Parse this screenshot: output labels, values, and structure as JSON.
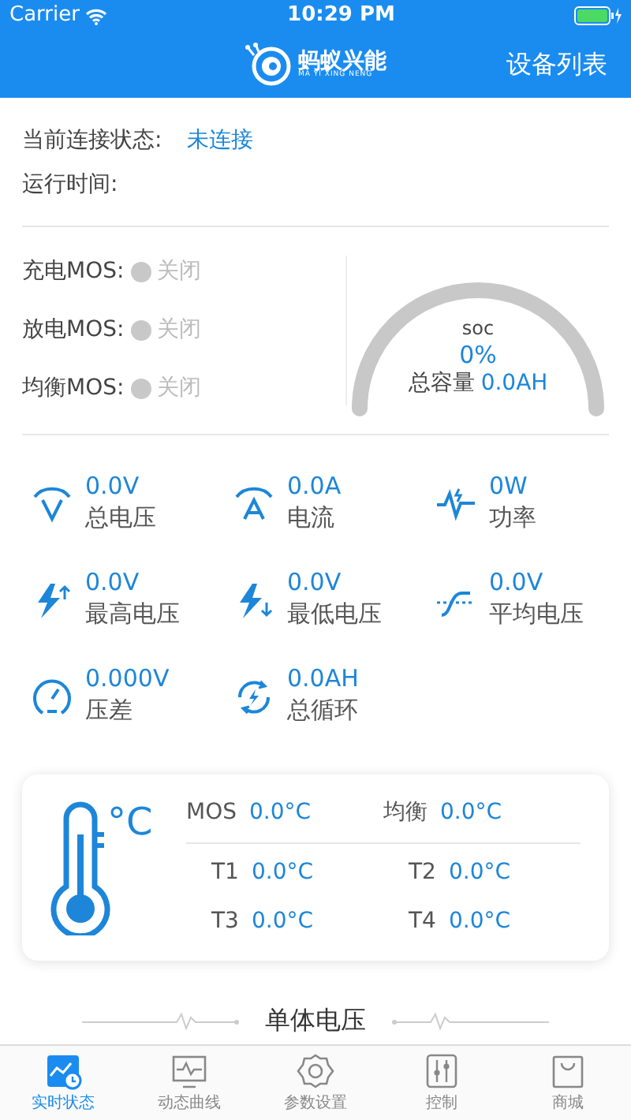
{
  "status_bar": {
    "carrier": "Carrier",
    "time": "10:29 PM"
  },
  "nav": {
    "logo_title": "蚂蚁兴能",
    "logo_subtitle": "MA YI XING NENG",
    "action": "设备列表"
  },
  "connection": {
    "label": "当前连接状态:",
    "value": "未连接"
  },
  "runtime": {
    "label": "运行时间:"
  },
  "mos": [
    {
      "label": "充电MOS:",
      "state": "关闭",
      "on": false
    },
    {
      "label": "放电MOS:",
      "state": "关闭",
      "on": false
    },
    {
      "label": "均衡MOS:",
      "state": "关闭",
      "on": false
    }
  ],
  "soc": {
    "label": "soc",
    "value": "0%",
    "capacity_label": "总容量",
    "capacity_value": "0.0AH"
  },
  "metrics": [
    {
      "value": "0.0V",
      "label": "总电压"
    },
    {
      "value": "0.0A",
      "label": "电流"
    },
    {
      "value": "0W",
      "label": "功率"
    },
    {
      "value": "0.0V",
      "label": "最高电压"
    },
    {
      "value": "0.0V",
      "label": "最低电压"
    },
    {
      "value": "0.0V",
      "label": "平均电压"
    },
    {
      "value": "0.000V",
      "label": "压差"
    },
    {
      "value": "0.0AH",
      "label": "总循环"
    }
  ],
  "temperature": {
    "unit": "°C",
    "top": [
      {
        "label": "MOS",
        "value": "0.0°C"
      },
      {
        "label": "均衡",
        "value": "0.0°C"
      }
    ],
    "sensors": [
      {
        "label": "T1",
        "value": "0.0°C"
      },
      {
        "label": "T2",
        "value": "0.0°C"
      },
      {
        "label": "T3",
        "value": "0.0°C"
      },
      {
        "label": "T4",
        "value": "0.0°C"
      }
    ]
  },
  "section_heading": "单体电压",
  "tabs": [
    {
      "label": "实时状态",
      "selected": true
    },
    {
      "label": "动态曲线",
      "selected": false
    },
    {
      "label": "参数设置",
      "selected": false
    },
    {
      "label": "控制",
      "selected": false
    },
    {
      "label": "商城",
      "selected": false
    }
  ]
}
